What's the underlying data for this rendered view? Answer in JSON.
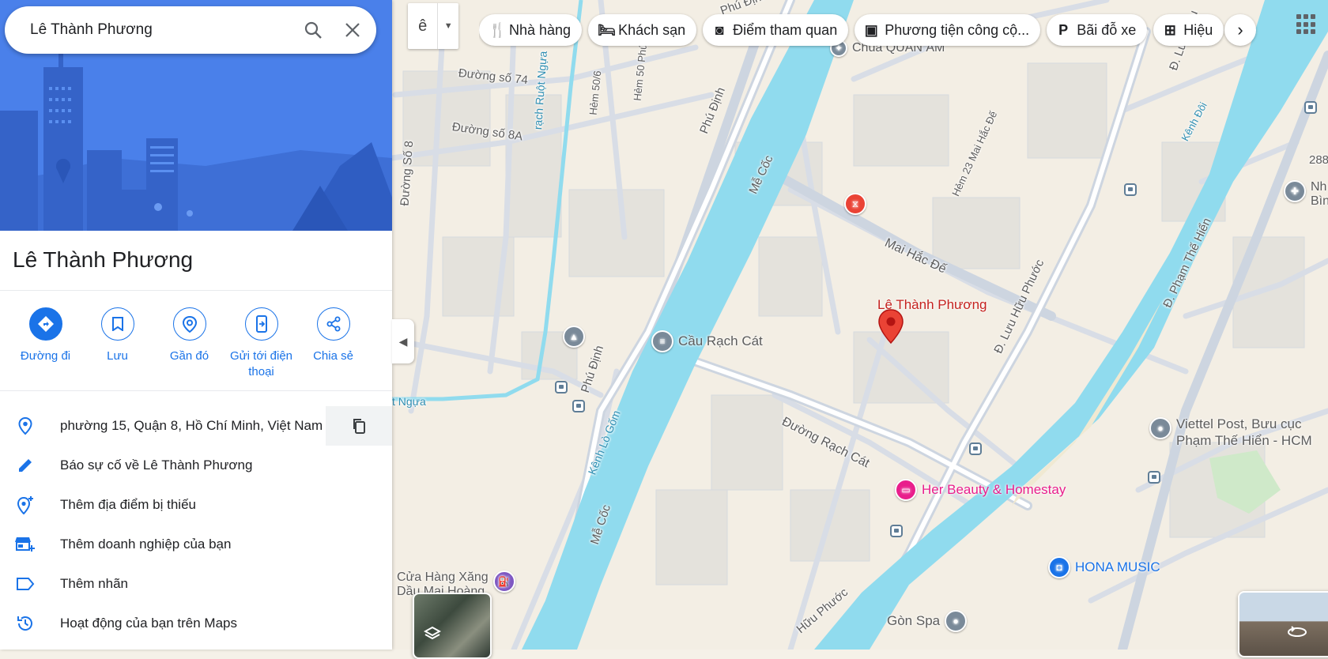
{
  "search": {
    "value": "Lê Thành Phương"
  },
  "place": {
    "title": "Lê Thành Phương"
  },
  "actions": [
    {
      "label": "Đường đi",
      "icon": "directions-icon"
    },
    {
      "label": "Lưu",
      "icon": "bookmark-icon"
    },
    {
      "label": "Gần đó",
      "icon": "nearby-icon"
    },
    {
      "label": "Gửi tới điện thoại",
      "icon": "send-to-phone-icon"
    },
    {
      "label": "Chia sẻ",
      "icon": "share-icon"
    }
  ],
  "info": {
    "address": "phường 15, Quận 8, Hồ Chí Minh, Việt Nam",
    "report": "Báo sự cố về Lê Thành Phương",
    "add_missing": "Thêm địa điểm bị thiếu",
    "add_business": "Thêm doanh nghiệp của bạn",
    "add_label": "Thêm nhãn",
    "activity": "Hoạt động của bạn trên Maps"
  },
  "ime": {
    "char": "ê"
  },
  "chips": [
    {
      "label": "Nhà hàng",
      "icon": "restaurant-icon"
    },
    {
      "label": "Khách sạn",
      "icon": "hotel-icon"
    },
    {
      "label": "Điểm tham quan",
      "icon": "camera-icon"
    },
    {
      "label": "Phương tiện công cộ...",
      "icon": "transit-icon"
    },
    {
      "label": "Bãi đỗ xe",
      "icon": "parking-icon"
    },
    {
      "label": "Hiệu",
      "icon": "pharmacy-icon"
    }
  ],
  "map": {
    "roads": {
      "phu_dinh_1": "Phú Định",
      "phu_dinh_2": "Phú Định",
      "phu_dinh_top": "Phú Định",
      "me_coc_1": "Mễ Cốc",
      "me_coc_2": "Mễ Cốc",
      "mai_hac_de": "Mai Hắc Đế",
      "hem_23": "Hẻm 23 Mai Hắc Đế",
      "luu_huu_phuoc": "Đ. Lưu Hữu Phước",
      "luu_huu_phuoc_bottom": "Hữu Phước",
      "luu_huu_top": "Đ. Lưu Hữu",
      "pham_the_hien": "Đ. Phạm Thế Hiển",
      "rach_cat": "Đường Rạch Cát",
      "duong_so_74": "Đường số 74",
      "duong_so_8a": "Đường số 8A",
      "duong_so_8": "Đường Số 8",
      "hem_50_6": "Hẻm 50/6",
      "hem_50_phu_dinh": "Hẻm 50 Phú Định",
      "num_288": "288"
    },
    "water": {
      "rach_ruot_ngua": "rạch Ruột Ngựa",
      "ruot_ngua_low": "t Ngựa",
      "kenh_lo_gom": "Kênh Lò Gốm",
      "kenh_doi": "Kênh Đôi"
    },
    "pois": {
      "main_pin": "Lê Thành Phương",
      "cau_rach_cat": "Cầu Rạch Cát",
      "her_beauty": "Her Beauty & Homestay",
      "hona_music": "HONA MUSIC",
      "viettel_1": "Viettel Post, Bưu cục",
      "viettel_2": "Phạm Thế Hiển - HCM",
      "gon_spa": "Gòn Spa",
      "chua_quan_am": "Chùa QUAN ÂM",
      "cua_hang_xang": "Cửa Hàng Xăng",
      "cua_hang_xang_2": "Dầu Mai Hoàng",
      "nh_bin_1": "Nh",
      "nh_bin_2": "Bìn"
    },
    "colors": {
      "water": "#90dbee",
      "land": "#f3eee4",
      "road": "#dfe3ea",
      "pin": "#ea4335",
      "poi_pink": "#e91e8c",
      "poi_blue": "#1a73e8"
    }
  }
}
